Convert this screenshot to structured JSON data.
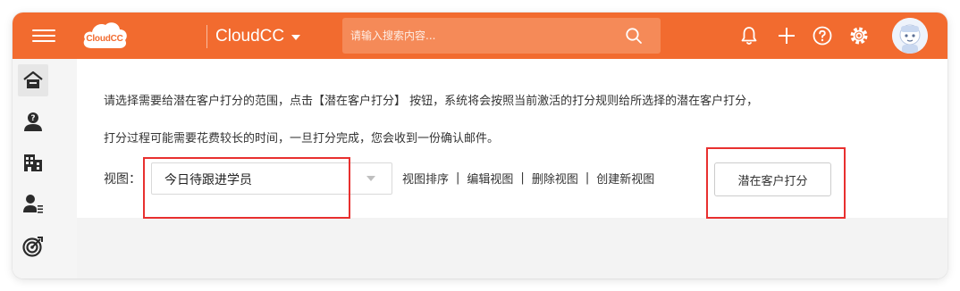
{
  "header": {
    "logo_text": "CloudCC",
    "app_name": "CloudCC",
    "search": {
      "placeholder": "请输入搜索内容..."
    },
    "icons": [
      "menu-icon",
      "bell-icon",
      "plus-icon",
      "help-icon",
      "gear-icon",
      "avatar"
    ]
  },
  "sidebar": {
    "items": [
      {
        "icon": "home-icon",
        "active": true
      },
      {
        "icon": "contact-question-icon",
        "active": false
      },
      {
        "icon": "building-icon",
        "active": false
      },
      {
        "icon": "person-list-icon",
        "active": false
      },
      {
        "icon": "target-icon",
        "active": false
      }
    ]
  },
  "main": {
    "instruction_line1": "请选择需要给潜在客户打分的范围，点击【潜在客户打分】 按钮，系统将会按照当前激活的打分规则给所选择的潜在客户打分，",
    "instruction_line2": "打分过程可能需要花费较长的时间，一旦打分完成，您会收到一份确认邮件。",
    "view_label": "视图：",
    "view_selected": "今日待跟进学员",
    "view_links": [
      "视图排序",
      "编辑视图",
      "删除视图",
      "创建新视图"
    ],
    "view_link_separator": "|",
    "score_button": "潜在客户打分"
  },
  "colors": {
    "brand_orange": "#f26b2f",
    "search_bg": "#f58a58",
    "highlight_red": "#e8302f"
  }
}
